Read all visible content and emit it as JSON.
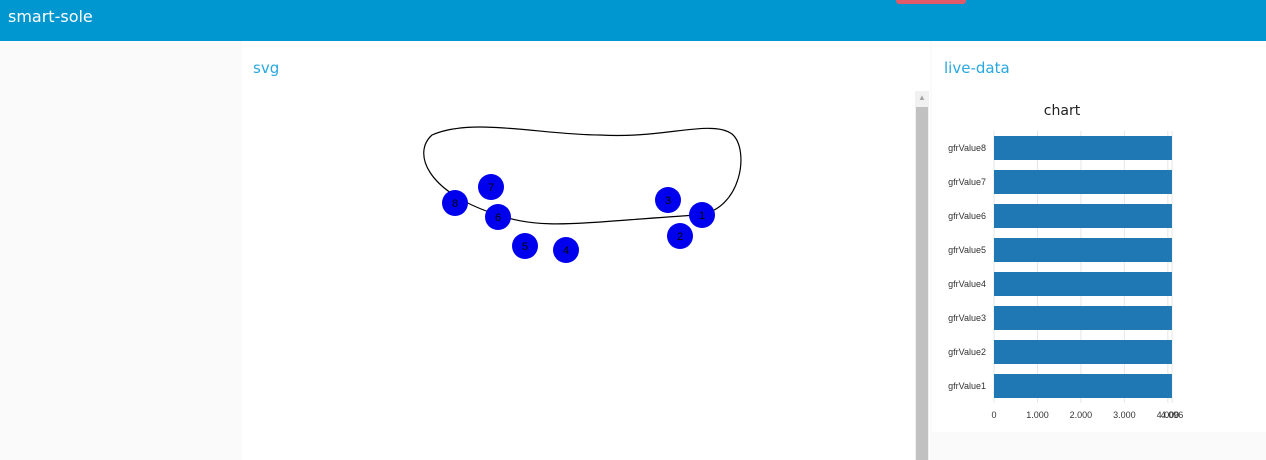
{
  "app": {
    "title": "smart-sole"
  },
  "svg_panel": {
    "title": "svg",
    "sensors": [
      {
        "label": "1"
      },
      {
        "label": "2"
      },
      {
        "label": "3"
      },
      {
        "label": "4"
      },
      {
        "label": "5"
      },
      {
        "label": "6"
      },
      {
        "label": "7"
      },
      {
        "label": "8"
      }
    ],
    "sensor_color": "#0000ee"
  },
  "live_panel": {
    "title": "live-data"
  },
  "chart_data": {
    "type": "bar",
    "orientation": "horizontal",
    "title": "chart",
    "categories": [
      "gfrValue8",
      "gfrValue7",
      "gfrValue6",
      "gfrValue5",
      "gfrValue4",
      "gfrValue3",
      "gfrValue2",
      "gfrValue1"
    ],
    "values": [
      4095,
      4095,
      4095,
      4095,
      4095,
      4095,
      4095,
      4095
    ],
    "xlim": [
      0,
      4096
    ],
    "x_ticks": [
      0,
      1000,
      2000,
      3000,
      4000,
      4096
    ],
    "x_tick_labels": [
      "0",
      "1.000",
      "2.000",
      "3.000",
      "4.000",
      "4.096"
    ],
    "bar_color": "#1f77b4",
    "grid": true
  },
  "colors": {
    "header": "#0096d0",
    "accent_text": "#29a8e0",
    "badge": "#e05a6a"
  }
}
